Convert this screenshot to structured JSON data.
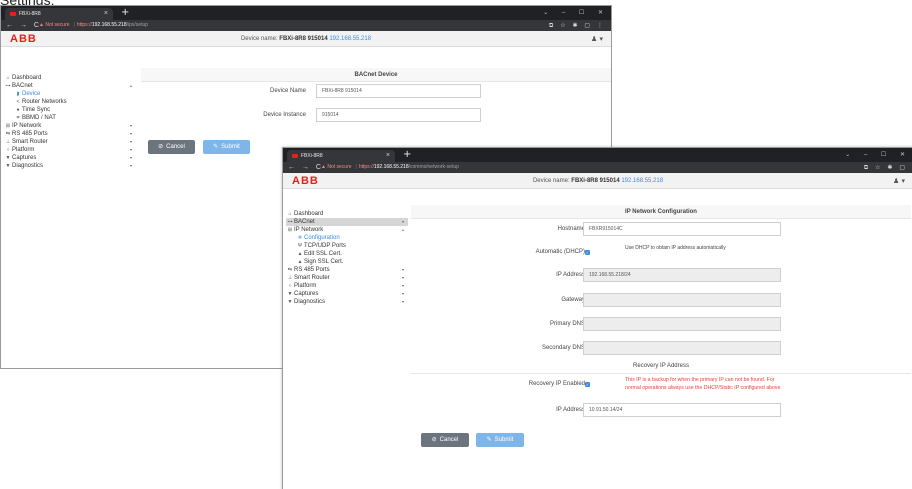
{
  "page_heading": "Settings:",
  "window1": {
    "browser": {
      "tab_title": "FBXi-8R8",
      "tab_close": "×",
      "new_tab": "+",
      "window_controls": "⌄ – ☐ ✕",
      "nav_buttons": "← → C",
      "not_secure": "Not secure",
      "url_scheme": "https://",
      "url_host": "192.168.55.218",
      "url_path": "/ipx/setup",
      "toolbar_icons": "⧉ ☆ ✱ ▢ ⋮"
    },
    "header": {
      "logo": "ABB",
      "device_prefix": "Device name:",
      "device_name": "FBXi-8R8 915014",
      "device_ip": "192.168.55.218",
      "user_menu": "♟ ▾"
    },
    "sidebar": {
      "dashboard": "Dashboard",
      "bacnet": "BACnet",
      "device": "Device",
      "router_networks": "Router Networks",
      "time_sync": "Time Sync",
      "bbmd_nat": "BBMD / NAT",
      "ip_network": "IP Network",
      "rs485": "RS 485 Ports",
      "smart_router": "Smart Router",
      "platform": "Platform",
      "captures": "Captures",
      "diagnostics": "Diagnostics"
    },
    "panel": {
      "title": "BACnet Device",
      "device_name_label": "Device Name",
      "device_name_value": "FBXi-8R8  915014",
      "device_instance_label": "Device Instance",
      "device_instance_value": "915014",
      "cancel_label": "Cancel",
      "submit_label": "Submit"
    }
  },
  "window2": {
    "browser": {
      "tab_title": "FBXi-8R8",
      "tab_close": "×",
      "new_tab": "+",
      "window_controls": "⌄ – ☐ ✕",
      "nav_buttons": "← → C",
      "not_secure": "Not secure",
      "url_scheme": "https://",
      "url_host": "192.168.55.218",
      "url_path": "/comms/network-setup",
      "toolbar_icons": "⧉ ☆ ✱ ▢"
    },
    "header": {
      "logo": "ABB",
      "device_prefix": "Device name:",
      "device_name": "FBXi-8R8 915014",
      "device_ip": "192.168.55.218",
      "user_menu": "♟ ▾"
    },
    "sidebar": {
      "dashboard": "Dashboard",
      "bacnet": "BACnet",
      "ip_network": "IP Network",
      "configuration": "Configuration",
      "tcp_udp": "TCP/UDP Ports",
      "edit_ssl": "Edit SSL Cert.",
      "sign_ssl": "Sign SSL Cert.",
      "rs485": "RS 485 Ports",
      "smart_router": "Smart Router",
      "platform": "Platform",
      "captures": "Captures",
      "diagnostics": "Diagnostics"
    },
    "panel": {
      "title": "IP Network Configuration",
      "hostname_label": "Hostname",
      "hostname_value": "FBXR915014C",
      "dhcp_label": "Automatic (DHCP)",
      "dhcp_note": "Use DHCP to obtain IP address automatically",
      "ip_label": "IP Address",
      "ip_value": "192.168.55.218/24",
      "gateway_label": "Gateway",
      "gateway_value": "",
      "primary_dns_label": "Primary DNS",
      "primary_dns_value": "",
      "secondary_dns_label": "Secondary DNS",
      "secondary_dns_value": "",
      "recovery_title": "Recovery IP Address",
      "recovery_enabled_label": "Recovery IP Enabled",
      "recovery_note_1": "This IP is a backup for when the primary IP can not be found. For",
      "recovery_note_2": "normal operations always use the DHCP/Static IP configured above",
      "recovery_ip_label": "IP Address",
      "recovery_ip_value": "10.91.50.14/24",
      "cancel_label": "Cancel",
      "submit_label": "Submit"
    }
  },
  "colors": {
    "abb_red": "#e2231a",
    "link_blue": "#3a8dde",
    "warning_red": "#e2463a",
    "cancel_gray": "#6c757d",
    "submit_blue": "#7fb6ea"
  }
}
